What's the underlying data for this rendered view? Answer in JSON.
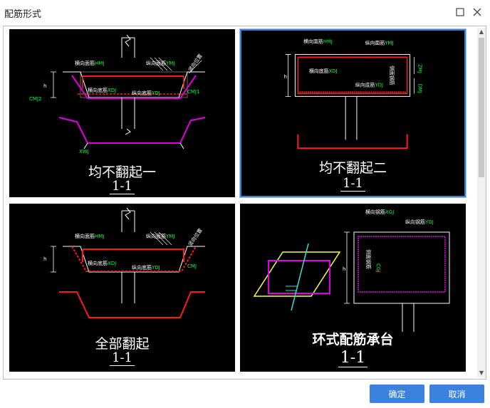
{
  "window": {
    "title": "配筋形式"
  },
  "tiles": [
    {
      "caption": "均不翻起一",
      "section": "1-1",
      "labels": {
        "top_transverse": "横向面筋",
        "top_transverse_code": "HMJ",
        "top_longitudinal": "纵向面筋",
        "top_longitudinal_code": "YMJ",
        "bot_transverse": "横向底筋",
        "bot_transverse_code": "XDJ",
        "bot_longitudinal": "纵向底筋",
        "bot_longitudinal_code": "YDJ",
        "h": "h",
        "cmj2": "CMJ2",
        "cmj1": "CMJ1",
        "ccmj": "CCMJ",
        "xwj": "XWJ",
        "hwj": "HWJ",
        "side_pos": "竖向位置"
      }
    },
    {
      "caption": "均不翻起二",
      "section": "1-1",
      "labels": {
        "top_transverse": "横向面筋",
        "top_transverse_code": "HMJ",
        "top_longitudinal": "纵向面筋",
        "top_longitudinal_code": "YMJ",
        "bot_transverse": "横向底筋",
        "bot_transverse_code": "XDJ",
        "bot_longitudinal": "纵向底筋",
        "bot_longitudinal_code": "YDJ",
        "h": "h",
        "cmj": "侧面钢筋",
        "zmj": "ZMJ",
        "zmj2": "ZMJ",
        "dmj": "DMJ",
        "dmj2": "DMJ"
      }
    },
    {
      "caption": "全部翻起",
      "section": "1-1",
      "labels": {
        "top_transverse": "横向面筋",
        "top_transverse_code": "HMJ",
        "top_longitudinal": "纵向面筋",
        "top_longitudinal_code": "YMJ",
        "bot_transverse": "横向底筋",
        "bot_transverse_code": "XDJ",
        "bot_longitudinal": "纵向底筋",
        "bot_longitudinal_code": "YDJ",
        "h": "h",
        "cmj": "CMJ",
        "side_pos": "竖向位置"
      }
    },
    {
      "caption": "环式配筋承台",
      "section": "1-1",
      "labels": {
        "top_transverse": "横向钢筋",
        "top_transverse_code": "XGJ",
        "top_longitudinal": "纵向钢筋",
        "top_longitudinal_code": "YGJ",
        "side": "侧面钢筋",
        "cgj": "CGJ",
        "h": "h"
      }
    }
  ],
  "buttons": {
    "ok": "确定",
    "cancel": "取消"
  },
  "icons": {
    "maximize": "maximize-icon",
    "close": "close-icon"
  },
  "colors": {
    "accent": "#3a82dd",
    "rebar_red": "#ff1a1a",
    "rebar_magenta": "#e000e0",
    "label_green": "#00ff44",
    "outline_white": "#ffffff"
  }
}
